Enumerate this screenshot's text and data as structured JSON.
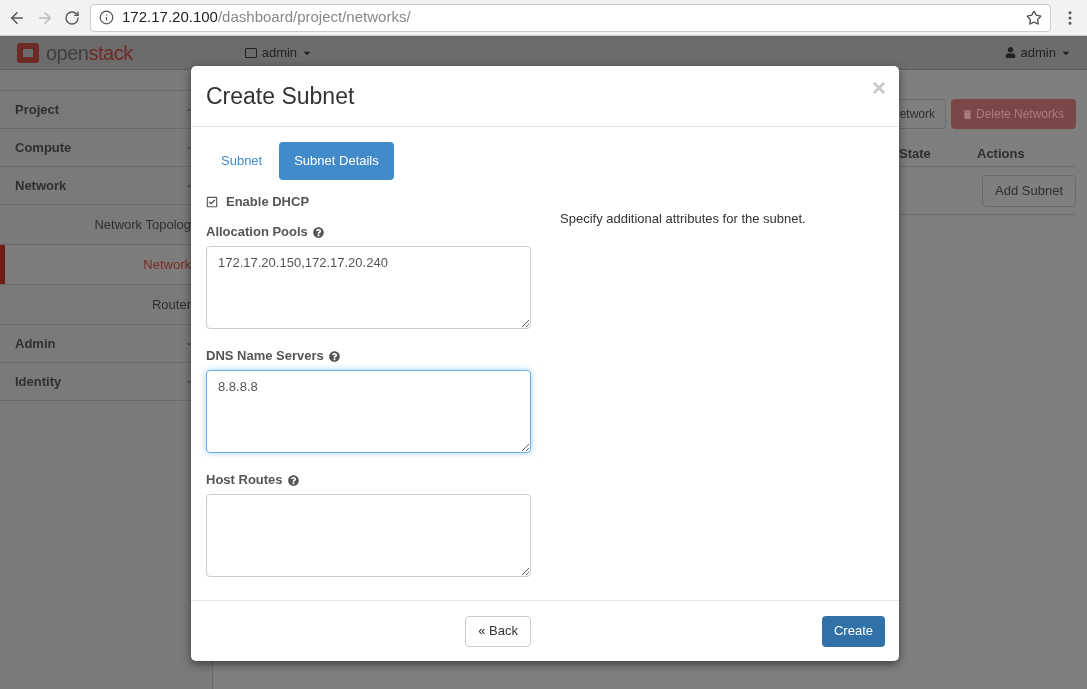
{
  "browser": {
    "url_host": "172.17.20.100",
    "url_path": "/dashboard/project/networks/"
  },
  "topbar": {
    "brand_start": "open",
    "brand_end": "stack",
    "project_menu": "admin",
    "user_menu": "admin"
  },
  "sidebar": [
    {
      "label": "Project",
      "expanded": true
    },
    {
      "label": "Compute",
      "expanded": false
    },
    {
      "label": "Network",
      "expanded": true,
      "children": [
        {
          "label": "Network Topolog",
          "selected": false
        },
        {
          "label": "Network",
          "selected": true
        },
        {
          "label": "Router",
          "selected": false
        }
      ]
    },
    {
      "label": "Admin",
      "expanded": false
    },
    {
      "label": "Identity",
      "expanded": false
    }
  ],
  "main": {
    "buttons": [
      {
        "label": "etwork",
        "kind": "default"
      },
      {
        "label": "Delete Networks",
        "kind": "danger"
      }
    ],
    "columns": [
      "State",
      "Actions"
    ],
    "row_action": "Add Subnet"
  },
  "modal": {
    "title": "Create Subnet",
    "close": "×",
    "tabs": [
      {
        "label": "Subnet",
        "selected": false
      },
      {
        "label": "Subnet Details",
        "selected": true
      }
    ],
    "enable_dhcp": {
      "label": "Enable DHCP",
      "checked": true
    },
    "fields": [
      {
        "label": "Allocation Pools",
        "value": "172.17.20.150,172.17.20.240",
        "focused": false
      },
      {
        "label": "DNS Name Servers",
        "value": "8.8.8.8",
        "focused": true
      },
      {
        "label": "Host Routes",
        "focused": false
      }
    ],
    "help_text": "Specify additional attributes for the subnet.",
    "back_button": "« Back",
    "create_button": "Create"
  }
}
